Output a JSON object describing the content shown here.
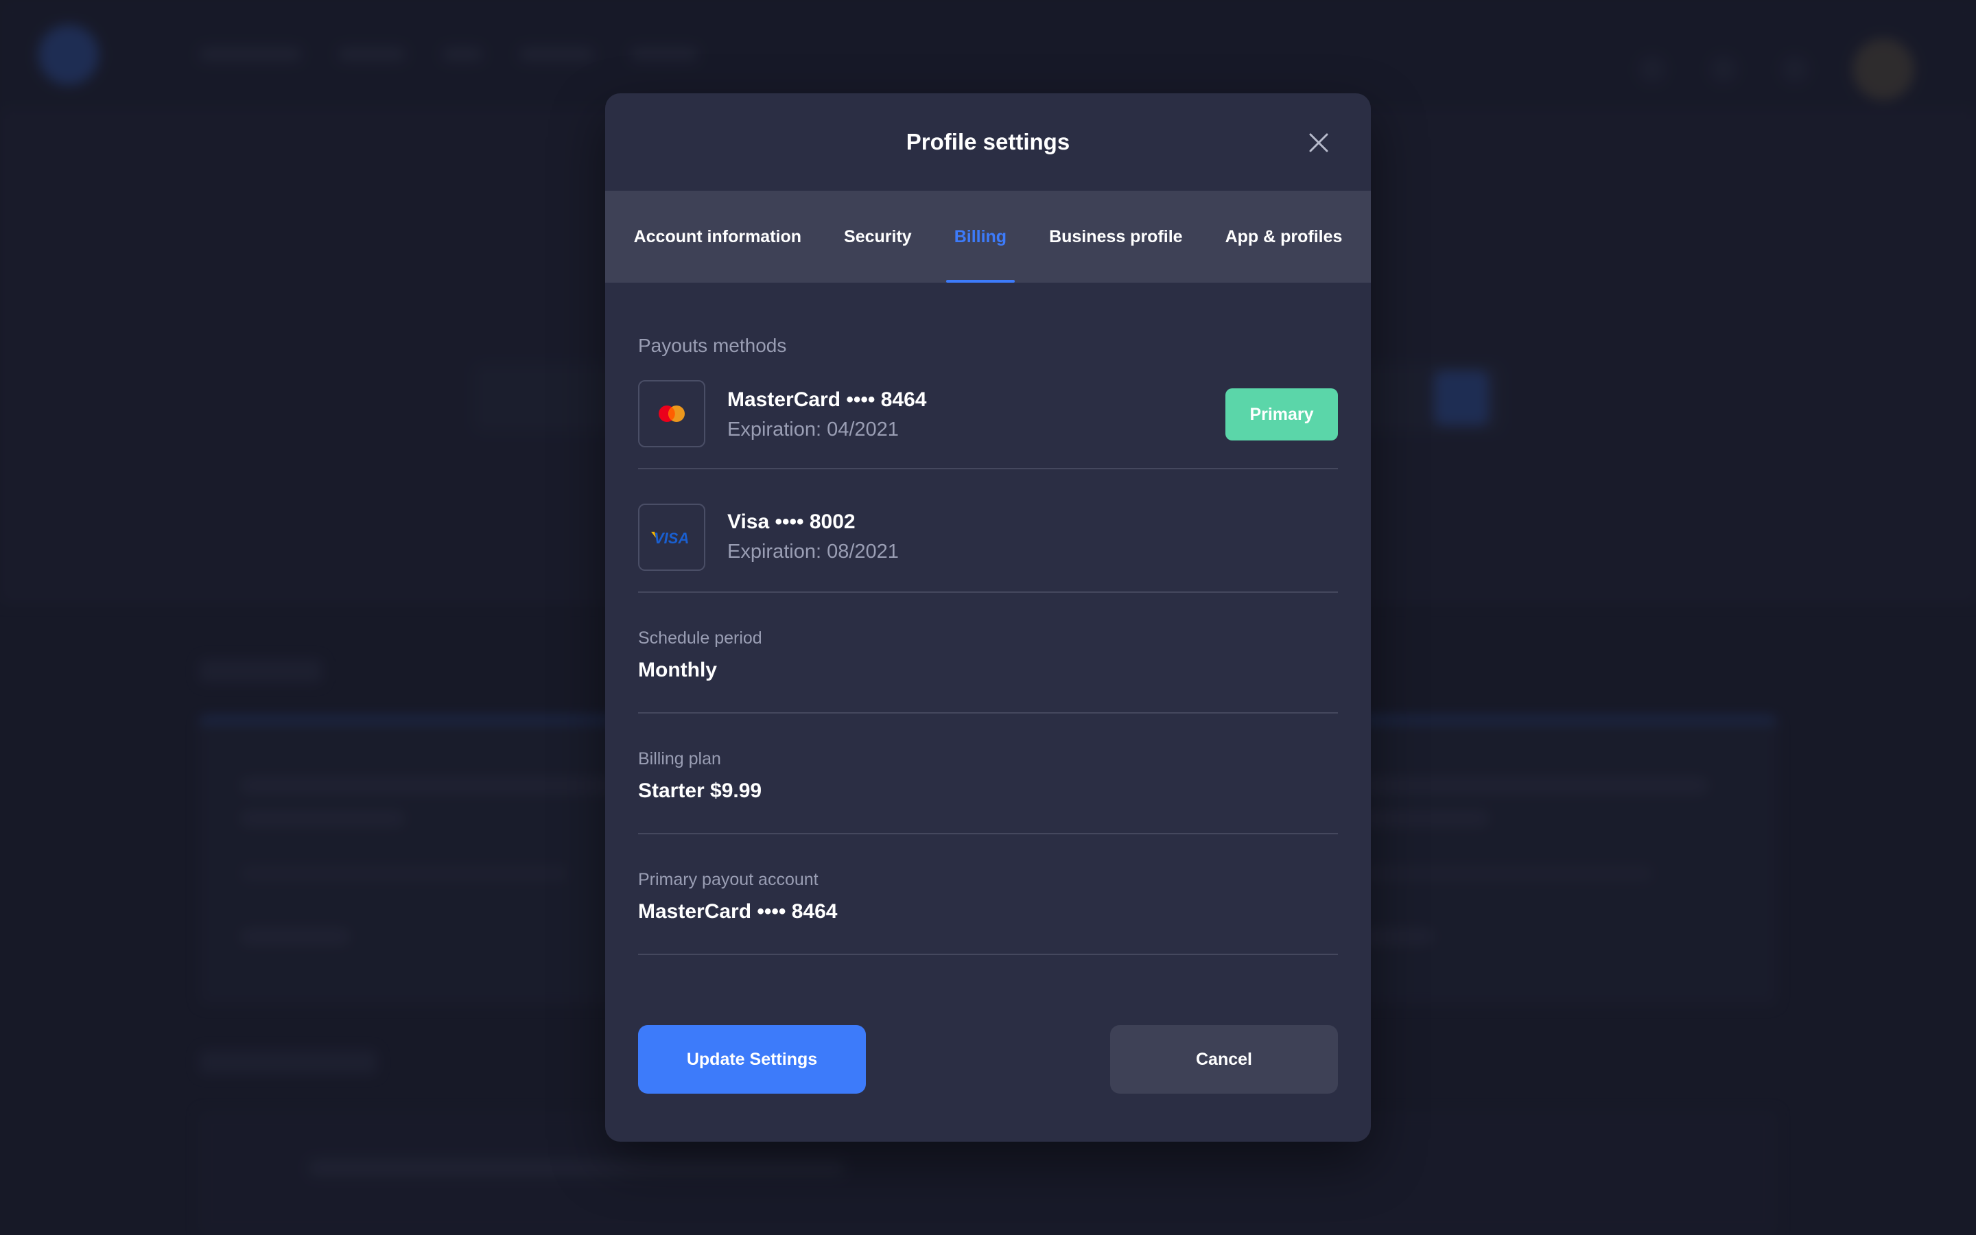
{
  "modal": {
    "title": "Profile settings"
  },
  "tabs": [
    {
      "label": "Account information",
      "active": false
    },
    {
      "label": "Security",
      "active": false
    },
    {
      "label": "Billing",
      "active": true
    },
    {
      "label": "Business profile",
      "active": false
    },
    {
      "label": "App & profiles",
      "active": false
    }
  ],
  "billing": {
    "section_title": "Payouts methods",
    "methods": [
      {
        "icon": "mastercard-icon",
        "name": "MasterCard •••• 8464",
        "expiration": "Expiration: 04/2021",
        "badge": "Primary"
      },
      {
        "icon": "visa-icon",
        "name": "Visa •••• 8002",
        "expiration": "Expiration: 08/2021",
        "logo_text": "VISA"
      }
    ],
    "fields": [
      {
        "label": "Schedule period",
        "value": "Monthly"
      },
      {
        "label": "Billing plan",
        "value": "Starter $9.99"
      },
      {
        "label": "Primary payout account",
        "value": "MasterCard •••• 8464"
      }
    ]
  },
  "actions": {
    "update_label": "Update Settings",
    "cancel_label": "Cancel"
  },
  "colors": {
    "accent": "#3d7bfa",
    "primary_badge": "#5bd6a9",
    "modal_bg": "#2b2e44",
    "tabs_bg": "#3e4156"
  }
}
